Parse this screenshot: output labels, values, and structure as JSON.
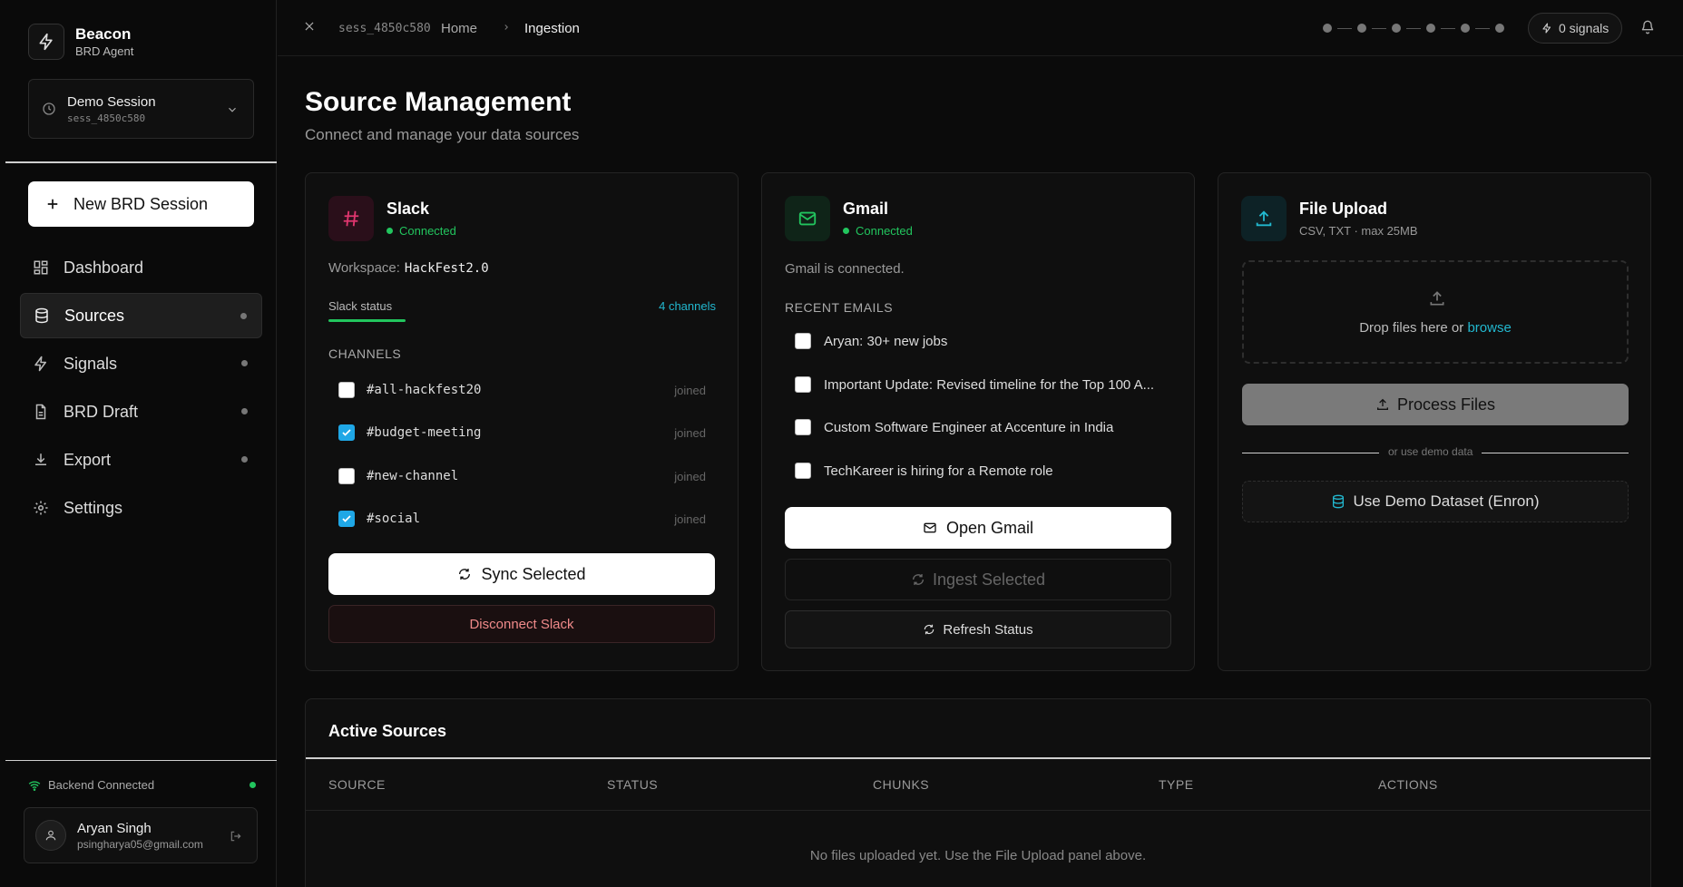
{
  "brand": {
    "name": "Beacon",
    "subtitle": "BRD Agent"
  },
  "session": {
    "name": "Demo Session",
    "id": "sess_4850c580"
  },
  "sidebar": {
    "new_button": "New BRD Session",
    "nav": [
      {
        "label": "Dashboard",
        "icon": "grid-icon"
      },
      {
        "label": "Sources",
        "icon": "database-icon",
        "active": true
      },
      {
        "label": "Signals",
        "icon": "bolt-icon"
      },
      {
        "label": "BRD Draft",
        "icon": "document-icon"
      },
      {
        "label": "Export",
        "icon": "download-icon"
      },
      {
        "label": "Settings",
        "icon": "gear-icon"
      }
    ],
    "backend_status": "Backend Connected",
    "user": {
      "name": "Aryan Singh",
      "email": "psingharya05@gmail.com"
    }
  },
  "topbar": {
    "session_id": "sess_4850c580",
    "breadcrumb": [
      "Home",
      "Ingestion"
    ],
    "signals": "0 signals"
  },
  "page": {
    "title": "Source Management",
    "subtitle": "Connect and manage your data sources"
  },
  "slack": {
    "title": "Slack",
    "status": "Connected",
    "workspace_label": "Workspace:",
    "workspace": "HackFest2.0",
    "status_label": "Slack status",
    "channel_count": "4 channels",
    "channels_heading": "CHANNELS",
    "channels": [
      {
        "name": "#all-hackfest20",
        "state": "joined",
        "checked": false
      },
      {
        "name": "#budget-meeting",
        "state": "joined",
        "checked": true
      },
      {
        "name": "#new-channel",
        "state": "joined",
        "checked": false
      },
      {
        "name": "#social",
        "state": "joined",
        "checked": true
      }
    ],
    "sync_button": "Sync Selected",
    "disconnect_button": "Disconnect Slack",
    "accent": "#e0366f"
  },
  "gmail": {
    "title": "Gmail",
    "status": "Connected",
    "note": "Gmail is connected.",
    "recent_heading": "RECENT EMAILS",
    "emails": [
      "Aryan: 30+ new jobs",
      "Important Update: Revised timeline for the Top 100 A...",
      "Custom Software Engineer at Accenture in India",
      "TechKareer is hiring for a Remote role"
    ],
    "open_button": "Open Gmail",
    "ingest_button": "Ingest Selected",
    "refresh_button": "Refresh Status",
    "accent": "#22c55e"
  },
  "upload": {
    "title": "File Upload",
    "subtitle": "CSV, TXT · max 25MB",
    "drop_text": "Drop files here or",
    "browse_link": "browse",
    "process_button": "Process Files",
    "divider_text": "or use demo data",
    "demo_button": "Use Demo Dataset (Enron)",
    "accent": "#22b8cf"
  },
  "active_sources": {
    "title": "Active Sources",
    "columns": [
      "SOURCE",
      "STATUS",
      "CHUNKS",
      "TYPE",
      "ACTIONS"
    ],
    "empty_text": "No files uploaded yet. Use the File Upload panel above."
  }
}
